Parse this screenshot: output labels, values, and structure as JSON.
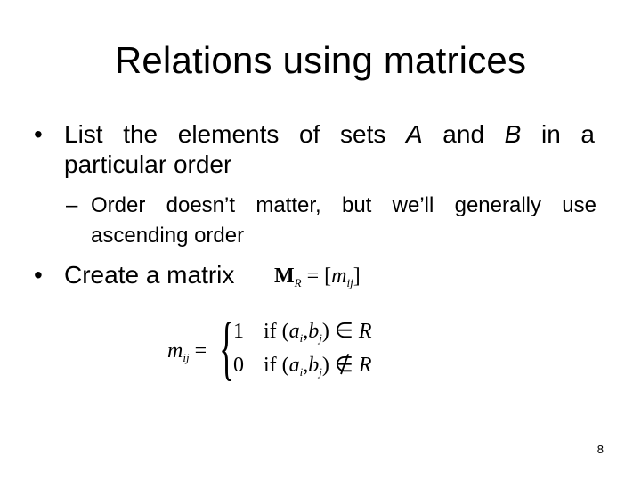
{
  "slide": {
    "title": "Relations using matrices",
    "page_number": "8",
    "bullets": [
      {
        "marker": "•",
        "line1_before": "List the elements of sets ",
        "set_a": "A",
        "line1_mid": " and ",
        "set_b": "B",
        "line1_after": " in a",
        "line2": "particular order",
        "sub_bullets": [
          {
            "marker": "–",
            "line1": "Order doesn’t matter, but we’ll generally use",
            "line2": "ascending order"
          }
        ]
      },
      {
        "marker": "•",
        "text": "Create a matrix"
      }
    ],
    "matrix_definition": {
      "lhs_symbol": "M",
      "lhs_subscript": "R",
      "equals": "=",
      "rhs_open": "[",
      "rhs_symbol": "m",
      "rhs_subscript": "ij",
      "rhs_close": "]"
    },
    "piecewise": {
      "lhs_symbol": "m",
      "lhs_subscript": "ij",
      "equals": "=",
      "brace": "{",
      "cases": [
        {
          "value": "1",
          "condition_word": "if",
          "open": "(",
          "a": "a",
          "a_sub": "i",
          "comma": ",",
          "b": "b",
          "b_sub": "j",
          "close": ")",
          "relation": "∈",
          "set": "R"
        },
        {
          "value": "0",
          "condition_word": "if",
          "open": "(",
          "a": "a",
          "a_sub": "i",
          "comma": ",",
          "b": "b",
          "b_sub": "j",
          "close": ")",
          "relation": "∉",
          "set": "R"
        }
      ]
    }
  }
}
